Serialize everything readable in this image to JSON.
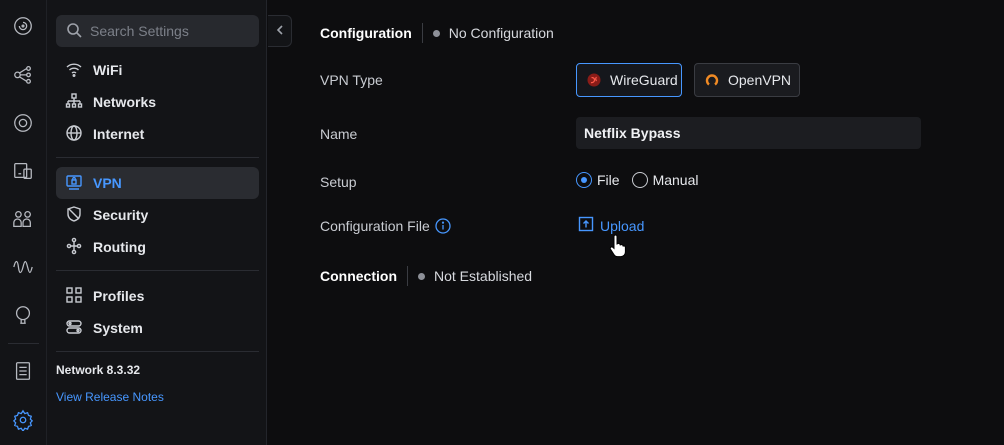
{
  "rail": {
    "icons": [
      "dashboard-icon",
      "topology-icon",
      "target-icon",
      "devices-icon",
      "clients-icon",
      "statistics-icon",
      "insights-icon",
      "logs-icon",
      "settings-icon"
    ]
  },
  "sidebar": {
    "search_placeholder": "Search Settings",
    "items": [
      {
        "label": "WiFi",
        "icon": "wifi-icon"
      },
      {
        "label": "Networks",
        "icon": "networks-icon"
      },
      {
        "label": "Internet",
        "icon": "globe-icon"
      },
      {
        "label": "VPN",
        "icon": "vpn-icon"
      },
      {
        "label": "Security",
        "icon": "shield-icon"
      },
      {
        "label": "Routing",
        "icon": "routing-icon"
      },
      {
        "label": "Profiles",
        "icon": "profiles-icon"
      },
      {
        "label": "System",
        "icon": "system-icon"
      }
    ],
    "active_item": "VPN",
    "version": "Network 8.3.32",
    "release_notes": "View Release Notes"
  },
  "main": {
    "configuration": {
      "title": "Configuration",
      "status": "No Configuration"
    },
    "vpn_type": {
      "label": "VPN Type",
      "options": [
        {
          "label": "WireGuard",
          "color": "#e0322c"
        },
        {
          "label": "OpenVPN",
          "color": "#f08a24"
        }
      ],
      "selected": "WireGuard"
    },
    "name": {
      "label": "Name",
      "value": "Netflix Bypass"
    },
    "setup": {
      "label": "Setup",
      "options": [
        "File",
        "Manual"
      ],
      "selected": "File"
    },
    "config_file": {
      "label": "Configuration File",
      "action": "Upload"
    },
    "connection": {
      "title": "Connection",
      "status": "Not Established"
    }
  },
  "colors": {
    "accent": "#4797ff",
    "background": "#0d0d0f",
    "sidebar": "#131417"
  }
}
